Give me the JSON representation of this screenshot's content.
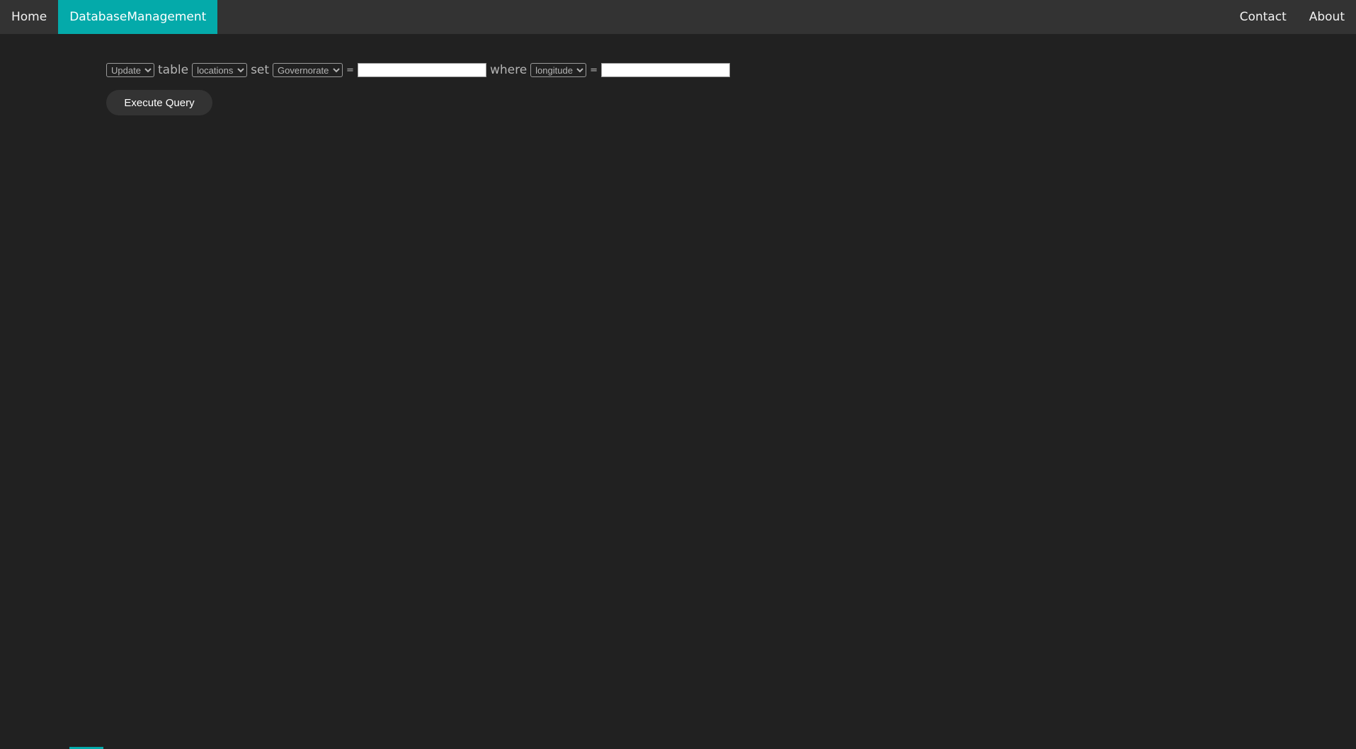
{
  "nav": {
    "home": "Home",
    "database_management": "DatabaseManagement",
    "contact": "Contact",
    "about": "About"
  },
  "query": {
    "action": {
      "selected": "Update",
      "options": [
        "Update"
      ]
    },
    "word_table": "table",
    "table": {
      "selected": "locations",
      "options": [
        "locations"
      ]
    },
    "word_set": "set",
    "set_column": {
      "selected": "Governorate",
      "options": [
        "Governorate"
      ]
    },
    "equals_1": "=",
    "set_value": "",
    "word_where": "where",
    "where_column": {
      "selected": "longitude",
      "options": [
        "longitude"
      ]
    },
    "equals_2": "=",
    "where_value": ""
  },
  "execute_button": "Execute Query",
  "colors": {
    "background": "#212121",
    "navbar": "#333333",
    "accent": "#04aaaa"
  }
}
